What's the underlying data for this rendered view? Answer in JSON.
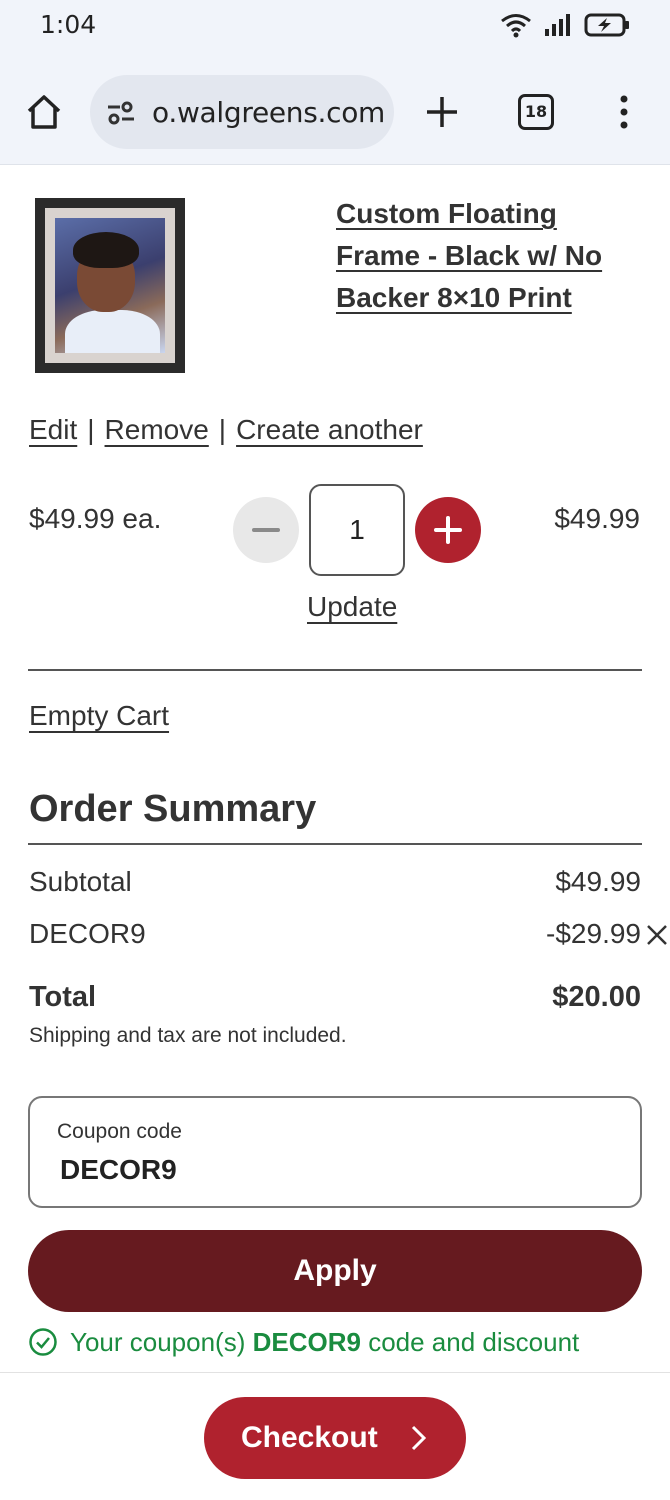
{
  "status_bar": {
    "time": "1:04"
  },
  "browser": {
    "url": "o.walgreens.com",
    "tab_count": "18"
  },
  "product": {
    "title_lines": [
      "Custom Floating",
      "Frame - Black w/ No",
      "Backer 8×10 Print"
    ],
    "actions": {
      "edit": "Edit",
      "remove": "Remove",
      "create_another": "Create another"
    },
    "unit_price": "$49.99 ea.",
    "quantity": "1",
    "line_total": "$49.99",
    "update": "Update"
  },
  "cart": {
    "empty_cart": "Empty Cart"
  },
  "summary": {
    "title": "Order Summary",
    "subtotal_label": "Subtotal",
    "subtotal_value": "$49.99",
    "coupon_label": "DECOR9",
    "coupon_value": "-$29.99",
    "total_label": "Total",
    "total_value": "$20.00",
    "note": "Shipping and tax are not included."
  },
  "coupon": {
    "field_label": "Coupon code",
    "field_value": "DECOR9",
    "apply": "Apply",
    "message_prefix": "Your coupon(s)",
    "message_code": "DECOR9",
    "message_suffix": "code and discount"
  },
  "checkout": {
    "label": "Checkout"
  },
  "colors": {
    "brand_red": "#b0222e",
    "dark_red": "#661a1f",
    "success_green": "#1a8c3f"
  }
}
